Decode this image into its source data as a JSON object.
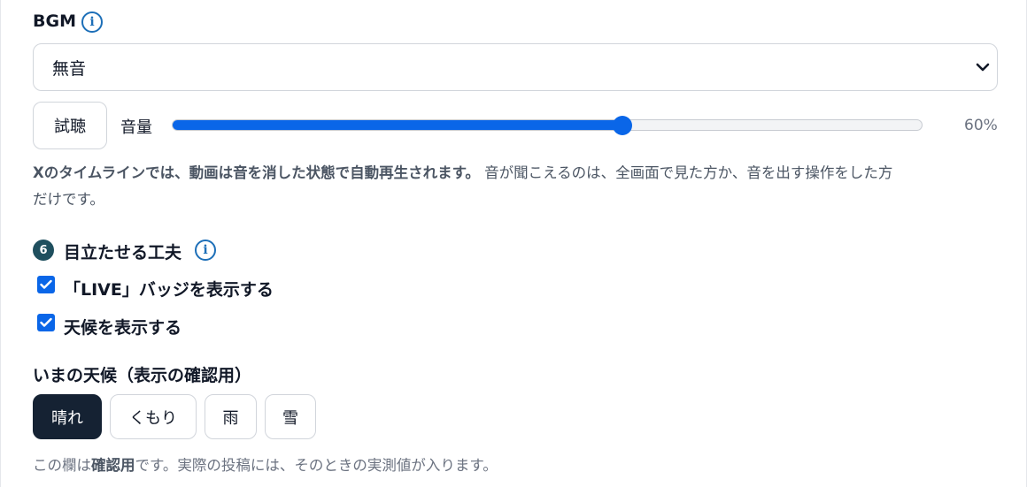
{
  "bgm": {
    "label": "BGM",
    "info_icon": "info-icon",
    "select_value": "無音"
  },
  "preview": {
    "button_label": "試聴",
    "volume_label": "音量",
    "volume_percent": 60,
    "volume_text": "60%"
  },
  "timeline_note": {
    "bold": "Xのタイムラインでは、動画は音を消した状態で自動再生されます。",
    "rest_line1": " 音が聞こえるのは、全画面で見た方か、音を出す操作をした方",
    "rest_line2": "だけです。"
  },
  "section6": {
    "number": "6",
    "title": "目立たせる工夫",
    "info_icon": "info-icon",
    "options": [
      {
        "label": "「LIVE」バッジを表示する",
        "checked": true
      },
      {
        "label": "天候を表示する",
        "checked": true
      }
    ]
  },
  "weather": {
    "heading": "いまの天候（表示の確認用）",
    "choices": [
      {
        "label": "晴れ",
        "selected": true
      },
      {
        "label": "くもり",
        "selected": false
      },
      {
        "label": "雨",
        "selected": false
      },
      {
        "label": "雪",
        "selected": false
      }
    ],
    "note_prefix": "この欄は",
    "note_bold": "確認用",
    "note_suffix": "です。実際の投稿には、そのときの実測値が入ります。"
  },
  "colors": {
    "accent": "#0a66e8",
    "selected_button": "#152233",
    "step_badge": "#1f4f5e",
    "info_icon": "#1d6fb8"
  }
}
